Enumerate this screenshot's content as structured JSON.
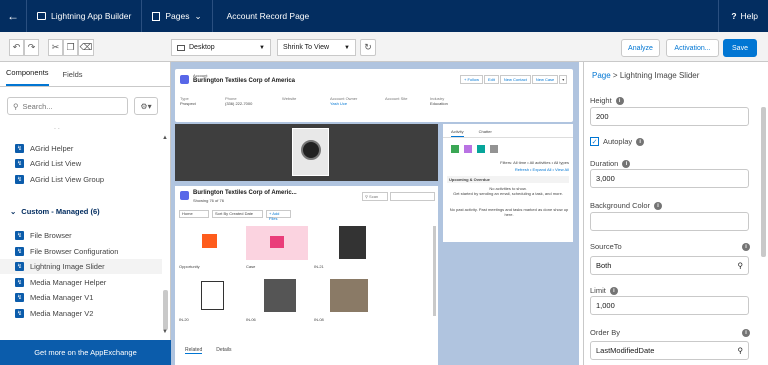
{
  "app": {
    "back_icon": "arrow-left-icon",
    "app_name": "Lightning App Builder",
    "pages_label": "Pages",
    "page_title": "Account Record Page",
    "help_label": "Help"
  },
  "toolbar": {
    "device": "Desktop",
    "view": "Shrink To View",
    "analyze": "Analyze",
    "activation": "Activation...",
    "save": "Save"
  },
  "left": {
    "tabs": [
      "Components",
      "Fields"
    ],
    "search_placeholder": "Search...",
    "items_top": [
      "AGrid Helper",
      "AGrid List View",
      "AGrid List View Group"
    ],
    "group_label": "Custom - Managed (6)",
    "items_custom": [
      "File Browser",
      "File Browser Configuration",
      "Lightning Image Slider",
      "Media Manager Helper",
      "Media Manager V1",
      "Media Manager V2"
    ],
    "exchange": "Get more on the AppExchange"
  },
  "canvas": {
    "record_type": "Account",
    "record_name": "Burlington Textiles Corp of America",
    "actions": [
      "+ Follow",
      "Edit",
      "New Contact",
      "New Case"
    ],
    "fields": [
      {
        "l": "Type",
        "v": "Prospect"
      },
      {
        "l": "Phone",
        "v": "(336) 222-7000"
      },
      {
        "l": "Website",
        "v": ""
      },
      {
        "l": "Account Owner",
        "v": "Yash Uce"
      },
      {
        "l": "Account Site",
        "v": ""
      },
      {
        "l": "Industry",
        "v": "Education"
      }
    ],
    "list_title": "Burlington Textiles Corp of Americ...",
    "list_sub": "Showing 76 of 76",
    "list_home": "Home",
    "list_sort": "Sort By Created Date",
    "list_add": "+ Add Files",
    "tile_labels": [
      "Opportunity",
      "Case",
      "IN-21",
      "IN-20",
      "IN-06",
      "IN-08"
    ],
    "activity_tabs": [
      "Activity",
      "Chatter"
    ],
    "upcoming": "Upcoming & Overdue",
    "no_act": "No activities to show.",
    "no_act_sub": "Get started by sending an email, scheduling a task, and more.",
    "past": "No past activity. Past meetings and tasks marked as done show up here.",
    "filters": "Filters: All time • All activities • All types",
    "refresh": "Refresh • Expand All • View All",
    "related_tabs": [
      "Related",
      "Details"
    ]
  },
  "right": {
    "crumb_page": "Page",
    "crumb_current": "Lightning Image Slider",
    "height_label": "Height",
    "height": "200",
    "autoplay_label": "Autoplay",
    "duration_label": "Duration",
    "duration": "3,000",
    "bg_label": "Background Color",
    "bg": "",
    "source_label": "SourceTo",
    "source": "Both",
    "limit_label": "Limit",
    "limit": "1,000",
    "order_label": "Order By",
    "order": "LastModifiedDate"
  }
}
